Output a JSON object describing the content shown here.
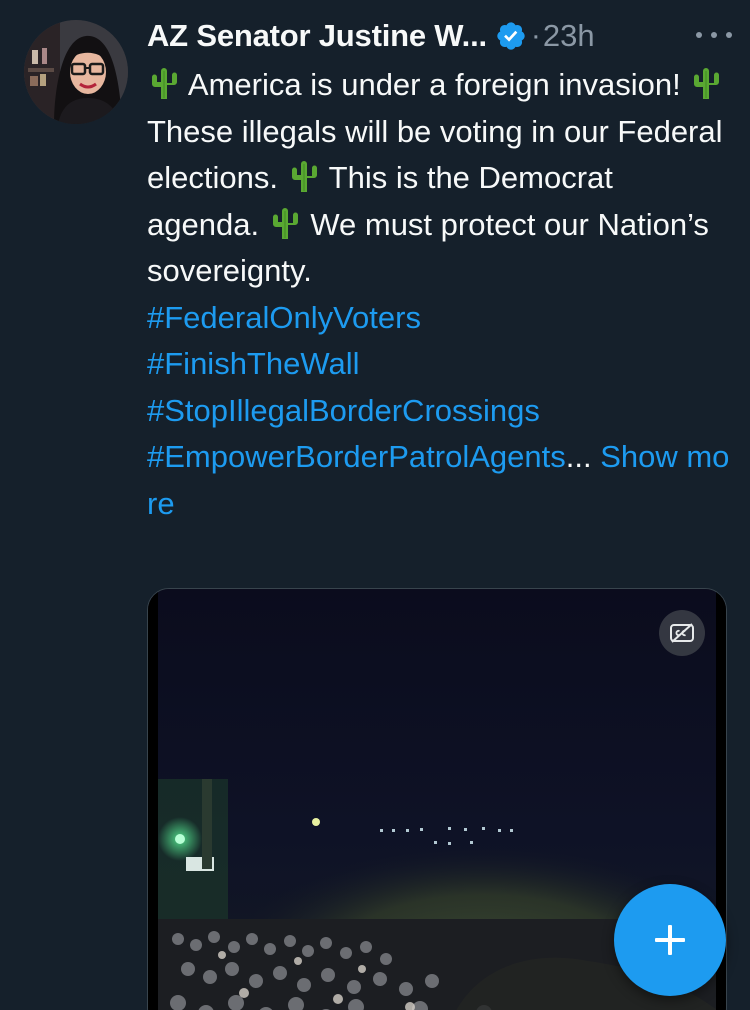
{
  "tweet": {
    "author_name": "AZ Senator Justine W...",
    "verified": true,
    "separator": "·",
    "time": "23h",
    "more_icon": "more-horizontal-icon",
    "text_lines": {
      "l1": "America is under a foreign invasion!",
      "l2": "These illegals will be voting in our Federal elections.",
      "l3": "This is the Democrat agenda.",
      "l4": "We must protect our Nation’s sovereignty."
    },
    "emoji": "🌵",
    "hashtags": [
      "#FederalOnlyVoters",
      "#FinishTheWall",
      "#StopIllegalBorderCrossings",
      "#EmpowerBorderPatrolAgents"
    ],
    "truncation": "...",
    "show_more_label": "Show more",
    "media": {
      "type": "video",
      "cc_icon": "captions-off-icon"
    }
  },
  "compose_button": {
    "icon": "plus-icon"
  },
  "colors": {
    "background": "#15202b",
    "text": "#f7f9f9",
    "secondary": "#8b98a5",
    "link": "#1d9bf0",
    "verified": "#1d9bf0"
  }
}
